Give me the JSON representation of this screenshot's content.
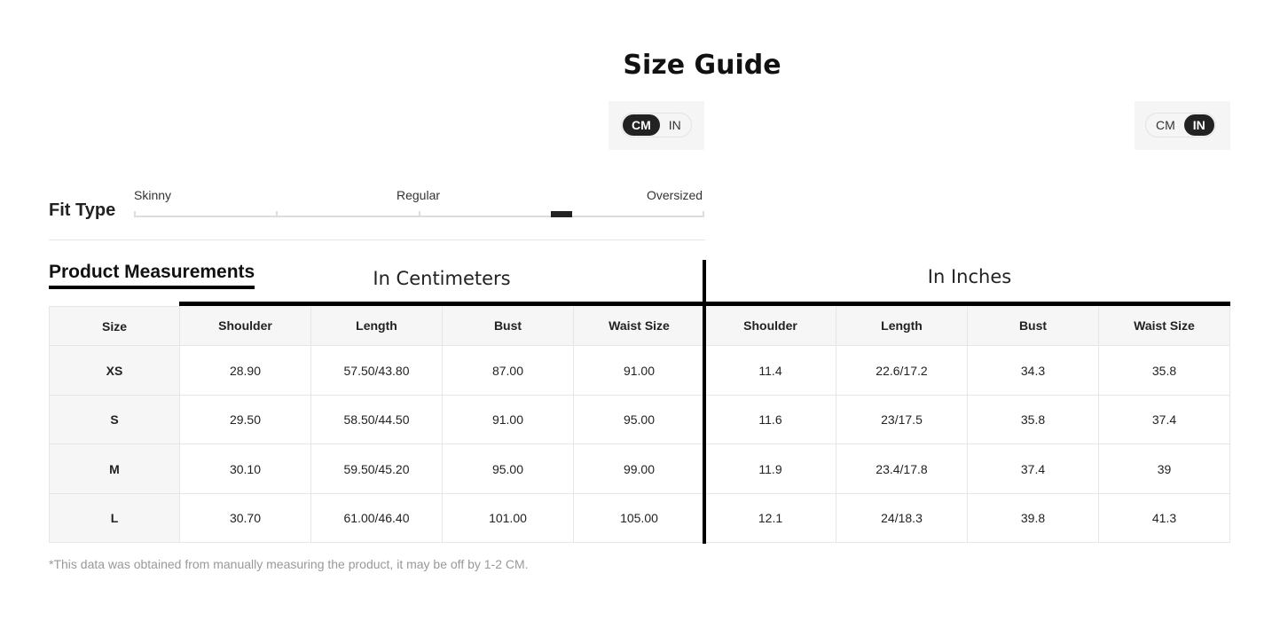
{
  "title": "Size Guide",
  "unit_toggles": [
    {
      "options": [
        "CM",
        "IN"
      ],
      "selected": "CM"
    },
    {
      "options": [
        "CM",
        "IN"
      ],
      "selected": "IN"
    }
  ],
  "fit_type": {
    "label": "Fit Type",
    "scale_labels": [
      "Skinny",
      "Regular",
      "Oversized"
    ],
    "level": 0.75
  },
  "product_measurements_title": "Product Measurements",
  "sections": {
    "cm": "In Centimeters",
    "in": "In Inches"
  },
  "table": {
    "headers": [
      "Size",
      "Shoulder",
      "Length",
      "Bust",
      "Waist Size",
      "Shoulder",
      "Length",
      "Bust",
      "Waist Size"
    ],
    "rows": [
      [
        "XS",
        "28.90",
        "57.50/43.80",
        "87.00",
        "91.00",
        "11.4",
        "22.6/17.2",
        "34.3",
        "35.8"
      ],
      [
        "S",
        "29.50",
        "58.50/44.50",
        "91.00",
        "95.00",
        "11.6",
        "23/17.5",
        "35.8",
        "37.4"
      ],
      [
        "M",
        "30.10",
        "59.50/45.20",
        "95.00",
        "99.00",
        "11.9",
        "23.4/17.8",
        "37.4",
        "39"
      ],
      [
        "L",
        "30.70",
        "61.00/46.40",
        "101.00",
        "105.00",
        "12.1",
        "24/18.3",
        "39.8",
        "41.3"
      ]
    ]
  },
  "note": "*This data was obtained from manually measuring the product, it may be off by 1-2 CM."
}
